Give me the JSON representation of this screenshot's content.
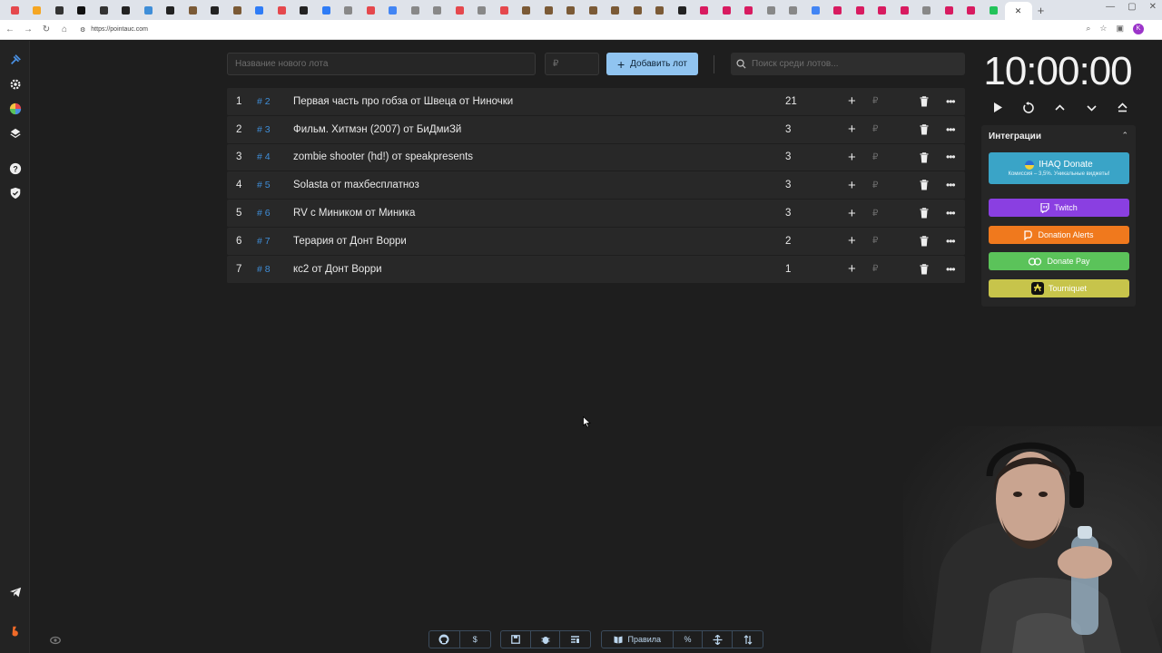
{
  "browser": {
    "url": "https://pointauc.com",
    "tab_colors": [
      "#e5484d",
      "#f5a623",
      "#333333",
      "#111111",
      "#333333",
      "#222222",
      "#3f8ed8",
      "#222222",
      "#7b5a36",
      "#222222",
      "#7b5a36",
      "#2f7cf6",
      "#e5484d",
      "#222222",
      "#2f7cf6",
      "#888888",
      "#e5484d",
      "#4285f4",
      "#888888",
      "#888888",
      "#e5484d",
      "#888888",
      "#e5484d",
      "#7b5a36",
      "#7b5a36",
      "#7b5a36",
      "#7b5a36",
      "#7b5a36",
      "#7b5a36",
      "#7b5a36",
      "#222222",
      "#d81b60",
      "#d81b60",
      "#d81b60",
      "#888888",
      "#888888",
      "#4285f4",
      "#d81b60",
      "#d81b60",
      "#d81b60",
      "#d81b60",
      "#888888",
      "#d81b60",
      "#d81b60",
      "#23c35a"
    ],
    "profile_letter": "K"
  },
  "sidebar": {
    "icons": [
      "auction-hammer-icon",
      "settings-gear-icon",
      "wheel-icon",
      "layers-icon",
      "help-icon",
      "shield-icon",
      "telegram-icon",
      "boosty-icon",
      "eye-icon"
    ]
  },
  "toolbar": {
    "lot_name_placeholder": "Название нового лота",
    "lot_price_placeholder": "₽",
    "add_label": "Добавить лот",
    "search_placeholder": "Поиск среди лотов..."
  },
  "lots": [
    {
      "index": "1",
      "id": "# 2",
      "title": "Первая часть про гобза от Швеца от Ниночки",
      "amount": "21"
    },
    {
      "index": "2",
      "id": "# 3",
      "title": "Фильм. Хитмэн (2007) от БиДмиЗй",
      "amount": "3"
    },
    {
      "index": "3",
      "id": "# 4",
      "title": "zombie shooter (hd!) от speakpresents",
      "amount": "3"
    },
    {
      "index": "4",
      "id": "# 5",
      "title": "Solasta от maxбесплатноз",
      "amount": "3"
    },
    {
      "index": "5",
      "id": "# 6",
      "title": "RV с Миником от Миника",
      "amount": "3"
    },
    {
      "index": "6",
      "id": "# 7",
      "title": "Терария  от Донт Ворри",
      "amount": "2"
    },
    {
      "index": "7",
      "id": "# 8",
      "title": "кс2 от Донт Ворри",
      "amount": "1"
    }
  ],
  "lot_currency": "₽",
  "timer": {
    "value": "10:00:00"
  },
  "integrations": {
    "title": "Интеграции",
    "ihaq_label": "IHAQ Donate",
    "ihaq_sub": "Комиссия – 3,5%. Уникальные виджеты!",
    "twitch": "Twitch",
    "donation_alerts": "Donation Alerts",
    "donate_pay": "Donate Pay",
    "tourniquet": "Tourniquet"
  },
  "bottom": {
    "rules_label": "Правила",
    "percent_label": "%"
  }
}
